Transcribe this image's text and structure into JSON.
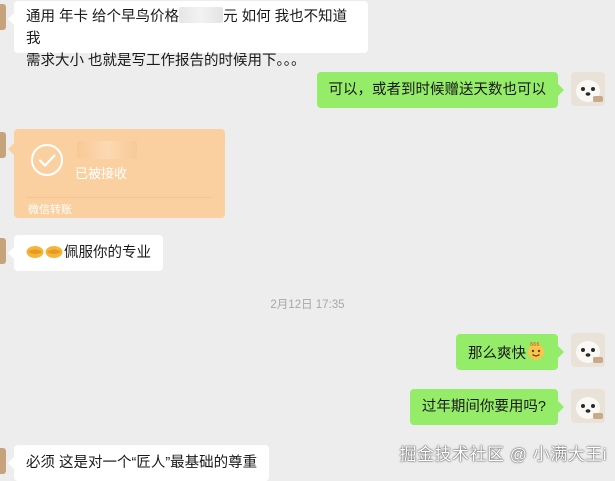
{
  "messages": {
    "m1": {
      "line1_a": "通用 年卡 给个早鸟价格",
      "line1_b": "元 如何  我也不知道我",
      "line2": "需求大小  也就是写工作报告的时候用下。。。"
    },
    "m2": {
      "text": "可以，或者到时候赠送天数也可以"
    },
    "transfer": {
      "status": "已被接收",
      "footer": "微信转账",
      "icon": "check-circle-icon"
    },
    "m3": {
      "emoji": "handshake",
      "text": "佩服你的专业"
    },
    "timestamp": "2月12日 17:35",
    "m4": {
      "text": "那么爽快",
      "emoji": "666-emoji"
    },
    "m5": {
      "text": "过年期间你要用吗?"
    },
    "m6": {
      "text": "必须 这是对一个“匠人”最基础的尊重"
    }
  },
  "watermark": "掘金技术社区 @ 小满大王i",
  "colors": {
    "background": "#ededed",
    "incoming_bubble": "#ffffff",
    "outgoing_bubble": "#95ec69",
    "transfer_card": "#fbd0a0"
  }
}
